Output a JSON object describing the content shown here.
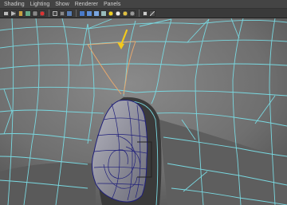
{
  "panel_menu": {
    "items": [
      "Shading",
      "Lighting",
      "Show",
      "Renderer",
      "Panels"
    ]
  },
  "toolbar": {
    "icons": [
      "camera-icon",
      "select-camera-icon",
      "bookmark-icon",
      "image-plane-icon",
      "grid-icon",
      "record-icon",
      "film-gate-icon",
      "resolution-gate-icon",
      "safe-action-icon",
      "wireframe-icon",
      "smooth-shade-icon",
      "flat-shade-icon",
      "bounding-box-icon",
      "textured-icon",
      "default-light-icon",
      "all-lights-icon",
      "shadows-icon",
      "xray-icon",
      "isolate-select-icon",
      "xray-joints-icon"
    ]
  },
  "viewport": {
    "colors": {
      "background": "#2b2b2b",
      "surface": "#7c7c7c",
      "wireframe": "#79d8e0",
      "highlight_edges": "#e6a86e",
      "arrow": "#f2c91c",
      "ear_mesh": "#9a9aa6",
      "ear_wire": "#1f1f7a"
    }
  }
}
